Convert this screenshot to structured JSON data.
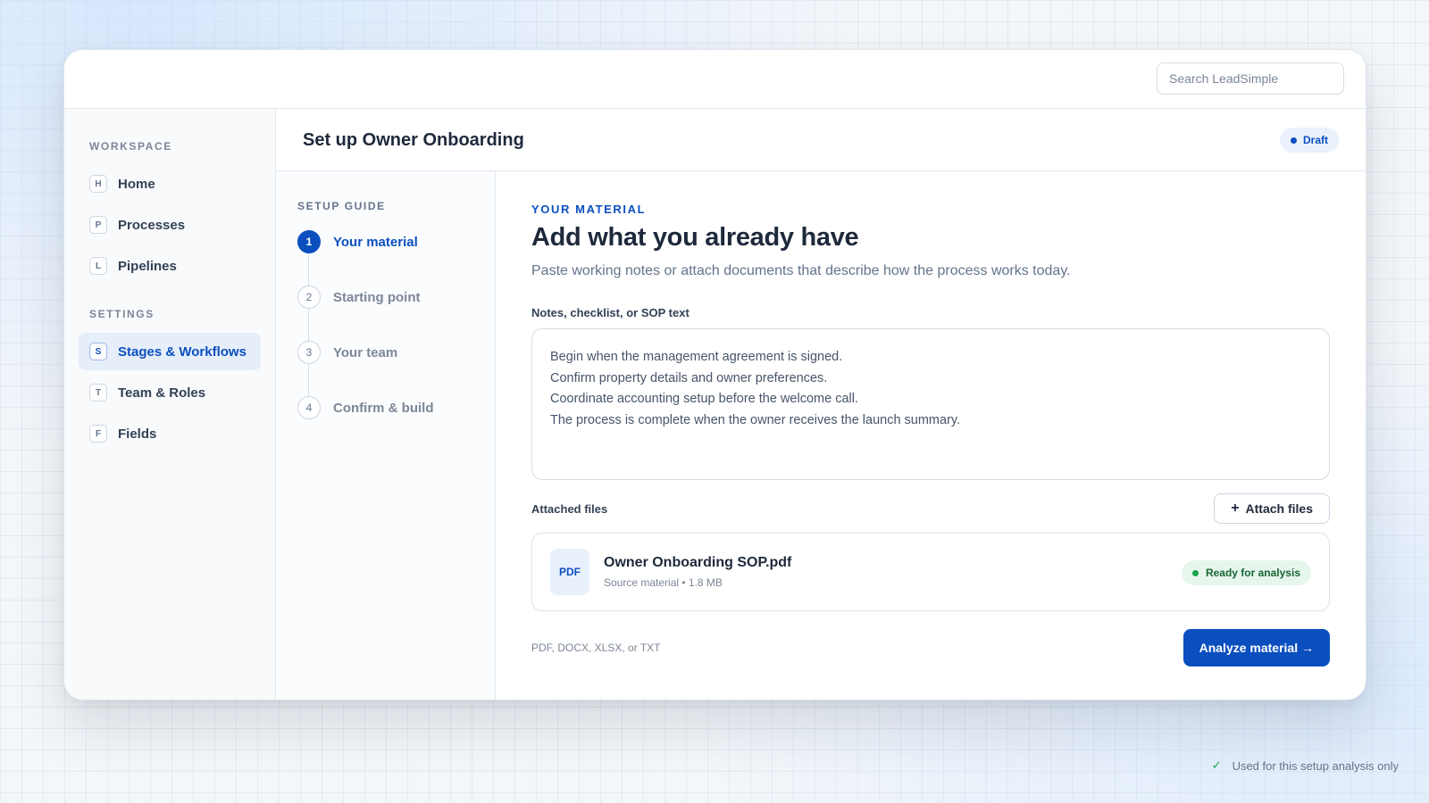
{
  "search": {
    "placeholder": "Search LeadSimple"
  },
  "sidebar": {
    "sections": [
      {
        "title": "WORKSPACE",
        "items": [
          {
            "key": "H",
            "label": "Home"
          },
          {
            "key": "P",
            "label": "Processes"
          },
          {
            "key": "L",
            "label": "Pipelines"
          }
        ]
      },
      {
        "title": "SETTINGS",
        "items": [
          {
            "key": "S",
            "label": "Stages & Workflows",
            "active": true
          },
          {
            "key": "T",
            "label": "Team & Roles"
          },
          {
            "key": "F",
            "label": "Fields"
          }
        ]
      }
    ]
  },
  "header": {
    "title": "Set up Owner Onboarding",
    "status": "Draft"
  },
  "guide": {
    "title": "SETUP GUIDE",
    "steps": [
      {
        "num": "1",
        "label": "Your material",
        "active": true
      },
      {
        "num": "2",
        "label": "Starting point"
      },
      {
        "num": "3",
        "label": "Your team"
      },
      {
        "num": "4",
        "label": "Confirm & build"
      }
    ]
  },
  "content": {
    "eyebrow": "YOUR MATERIAL",
    "headline": "Add what you already have",
    "subtitle": "Paste working notes or attach documents that describe how the process works today.",
    "notes_label": "Notes, checklist, or SOP text",
    "notes": [
      "Begin when the management agreement is signed.",
      "Confirm property details and owner preferences.",
      "Coordinate accounting setup before the welcome call.",
      "The process is complete when the owner receives the launch summary."
    ],
    "files_label": "Attached files",
    "attach_label": "Attach files",
    "file": {
      "type": "PDF",
      "name": "Owner Onboarding SOP.pdf",
      "meta": "Source material • 1.8 MB",
      "status": "Ready for analysis"
    },
    "formats": "PDF, DOCX, XLSX, or TXT",
    "analyze_label": "Analyze material →"
  },
  "privacy_note": "Used for this setup analysis only",
  "colors": {
    "accent": "#0b4fbf",
    "success": "#16a34a"
  }
}
